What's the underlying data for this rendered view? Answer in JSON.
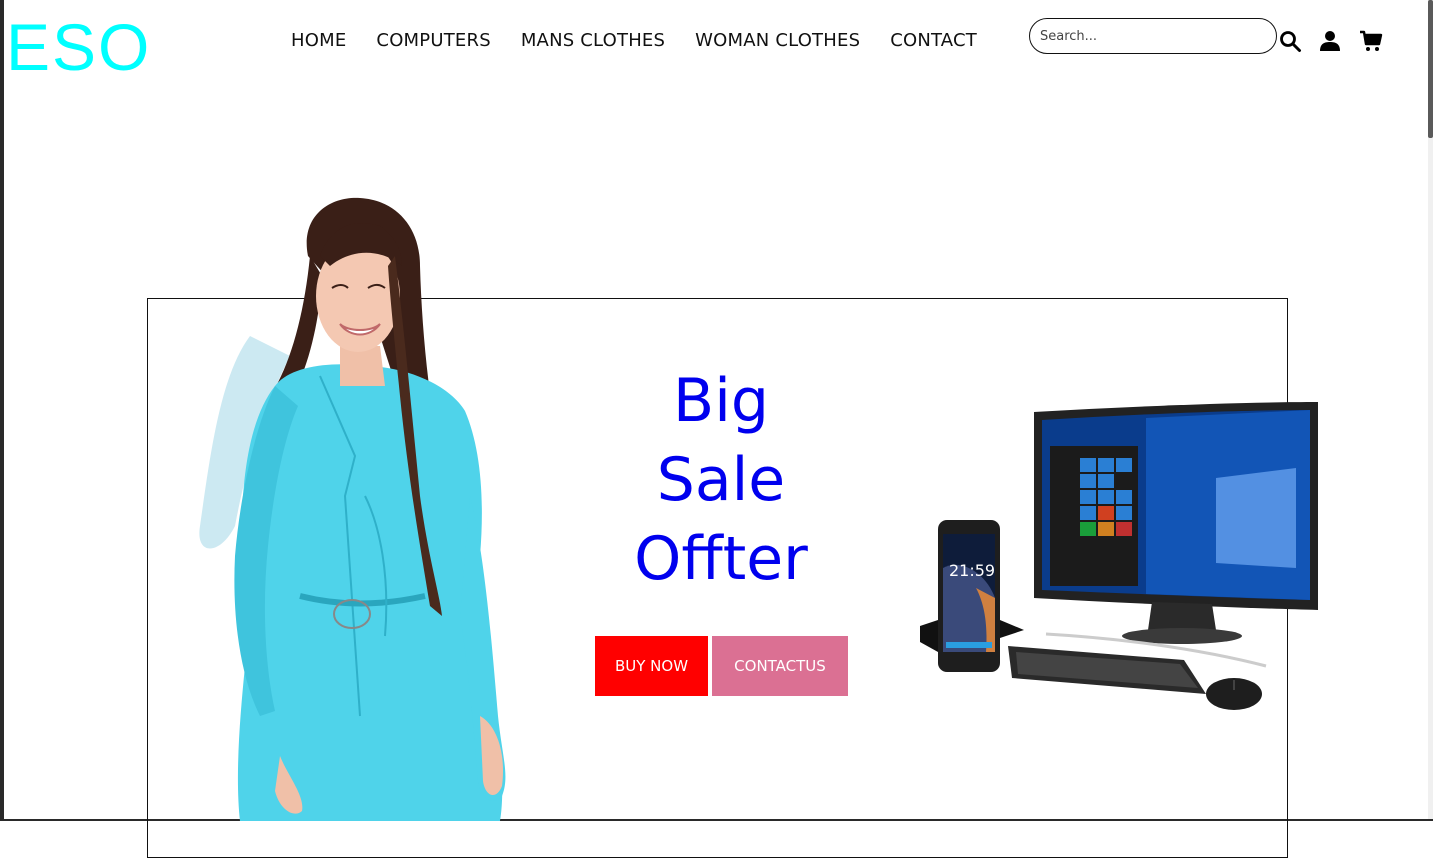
{
  "brand": {
    "logo": "ESO",
    "logo_color": "#00ffff"
  },
  "nav": {
    "items": [
      {
        "label": "HOME"
      },
      {
        "label": "COMPUTERS"
      },
      {
        "label": "MANS CLOTHES"
      },
      {
        "label": "WOMAN CLOTHES"
      },
      {
        "label": "CONTACT"
      }
    ]
  },
  "search": {
    "placeholder": "Search...",
    "value": ""
  },
  "header_icons": [
    "search-icon",
    "user-icon",
    "cart-icon"
  ],
  "hero": {
    "headline_lines": [
      "Big",
      "Sale",
      "Offter"
    ],
    "headline_color": "#0000ee",
    "buy_label": "BUY NOW",
    "buy_color": "#ff0000",
    "contact_label": "CONTACTUS",
    "contact_color": "#db7093",
    "images": [
      "woman-in-blue-dress",
      "computer-and-phone"
    ]
  }
}
